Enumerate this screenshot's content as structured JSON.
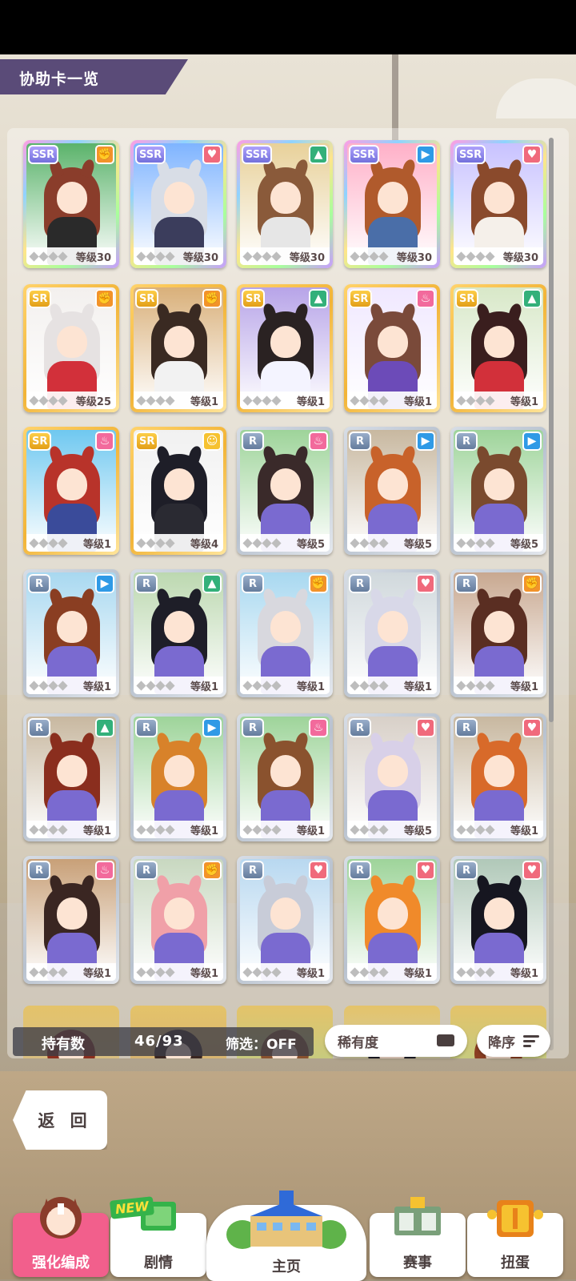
{
  "header": {
    "title": "协助卡一览"
  },
  "cards": [
    {
      "rarity": "SSR",
      "type": "power",
      "level": "等级30",
      "hair": "#8a3d2b",
      "bg": "#5bb36b",
      "outfit": "#2a2a2a"
    },
    {
      "rarity": "SSR",
      "type": "stamina",
      "level": "等级30",
      "hair": "#d8dde6",
      "bg": "#7fb4ff",
      "outfit": "#3b3d5c"
    },
    {
      "rarity": "SSR",
      "type": "wisdom",
      "level": "等级30",
      "hair": "#8a5a3a",
      "bg": "#e8d19a",
      "outfit": "#e6e6e6"
    },
    {
      "rarity": "SSR",
      "type": "speed",
      "level": "等级30",
      "hair": "#b05a2c",
      "bg": "#ffb0c8",
      "outfit": "#4a6ea8"
    },
    {
      "rarity": "SSR",
      "type": "stamina",
      "level": "等级30",
      "hair": "#8a4a2c",
      "bg": "#c8c2ff",
      "outfit": "#f5f0ea"
    },
    {
      "rarity": "SR",
      "type": "power",
      "level": "等级25",
      "hair": "#e6e2e2",
      "bg": "#f3f0ee",
      "outfit": "#d2303a"
    },
    {
      "rarity": "SR",
      "type": "power",
      "level": "等级1",
      "hair": "#3a2a22",
      "bg": "#d9b07a",
      "outfit": "#f2f2f2"
    },
    {
      "rarity": "SR",
      "type": "wisdom",
      "level": "等级1",
      "hair": "#2a2222",
      "bg": "#b7a4e8",
      "outfit": "#f4f4ff"
    },
    {
      "rarity": "SR",
      "type": "guts",
      "level": "等级1",
      "hair": "#7a4a3a",
      "bg": "#f0e8ff",
      "outfit": "#6c4bb8"
    },
    {
      "rarity": "SR",
      "type": "wisdom",
      "level": "等级1",
      "hair": "#3a1e1e",
      "bg": "#d8e8c8",
      "outfit": "#d2303a"
    },
    {
      "rarity": "SR",
      "type": "guts",
      "level": "等级1",
      "hair": "#b8332a",
      "bg": "#6fc8f0",
      "outfit": "#3a4b9a"
    },
    {
      "rarity": "SR",
      "type": "friend",
      "level": "等级4",
      "hair": "#1e1e28",
      "bg": "#f1f1f1",
      "outfit": "#2a2a32"
    },
    {
      "rarity": "R",
      "type": "guts",
      "level": "等级5",
      "hair": "#3a2a2a",
      "bg": "#9ed49a",
      "outfit": "#7a6ad0"
    },
    {
      "rarity": "R",
      "type": "speed",
      "level": "等级5",
      "hair": "#c8622a",
      "bg": "#c8b8a0",
      "outfit": "#7a6ad0"
    },
    {
      "rarity": "R",
      "type": "speed",
      "level": "等级5",
      "hair": "#7a4a2e",
      "bg": "#9ed49a",
      "outfit": "#7a6ad0"
    },
    {
      "rarity": "R",
      "type": "speed",
      "level": "等级1",
      "hair": "#8a3e22",
      "bg": "#a8d8f0",
      "outfit": "#7a6ad0"
    },
    {
      "rarity": "R",
      "type": "wisdom",
      "level": "等级1",
      "hair": "#1e1e28",
      "bg": "#bcd8b0",
      "outfit": "#7a6ad0"
    },
    {
      "rarity": "R",
      "type": "power",
      "level": "等级1",
      "hair": "#d8d8de",
      "bg": "#a8d8f0",
      "outfit": "#7a6ad0"
    },
    {
      "rarity": "R",
      "type": "stamina",
      "level": "等级1",
      "hair": "#d8d8e8",
      "bg": "#d0d8dc",
      "outfit": "#7a6ad0"
    },
    {
      "rarity": "R",
      "type": "power",
      "level": "等级1",
      "hair": "#5a2e22",
      "bg": "#c8a890",
      "outfit": "#7a6ad0"
    },
    {
      "rarity": "R",
      "type": "wisdom",
      "level": "等级1",
      "hair": "#8a2e1e",
      "bg": "#c8b8a0",
      "outfit": "#7a6ad0"
    },
    {
      "rarity": "R",
      "type": "speed",
      "level": "等级1",
      "hair": "#d8822a",
      "bg": "#9ed49a",
      "outfit": "#7a6ad0"
    },
    {
      "rarity": "R",
      "type": "guts",
      "level": "等级1",
      "hair": "#8a522e",
      "bg": "#9ed49a",
      "outfit": "#7a6ad0"
    },
    {
      "rarity": "R",
      "type": "stamina",
      "level": "等级5",
      "hair": "#d8d0e8",
      "bg": "#d8d0c8",
      "outfit": "#7a6ad0"
    },
    {
      "rarity": "R",
      "type": "stamina",
      "level": "等级1",
      "hair": "#d86a2a",
      "bg": "#c8b8a0",
      "outfit": "#7a6ad0"
    },
    {
      "rarity": "R",
      "type": "guts",
      "level": "等级1",
      "hair": "#3a2622",
      "bg": "#c8a078",
      "outfit": "#7a6ad0"
    },
    {
      "rarity": "R",
      "type": "power",
      "level": "等级1",
      "hair": "#f0a0a8",
      "bg": "#c8d8c0",
      "outfit": "#7a6ad0"
    },
    {
      "rarity": "R",
      "type": "stamina",
      "level": "等级1",
      "hair": "#c8ccd8",
      "bg": "#b8d8f0",
      "outfit": "#7a6ad0"
    },
    {
      "rarity": "R",
      "type": "stamina",
      "level": "等级1",
      "hair": "#f08a2a",
      "bg": "#9ed49a",
      "outfit": "#7a6ad0"
    },
    {
      "rarity": "R",
      "type": "stamina",
      "level": "等级1",
      "hair": "#161620",
      "bg": "#b0c8b8",
      "outfit": "#7a6ad0"
    }
  ],
  "partial_cards": [
    {
      "hair": "#8a2e1e",
      "bg": "#c8b8a0"
    },
    {
      "hair": "#3a2622",
      "bg": "#c8a078"
    },
    {
      "hair": "#8a522e",
      "bg": "#9ed49a"
    },
    {
      "hair": "#1e1e28",
      "bg": "#b8d8f0"
    },
    {
      "hair": "#8a3e22",
      "bg": "#9ed49a"
    }
  ],
  "filter_bar": {
    "own_label": "持有数",
    "own_count": "46/93",
    "filter_label": "筛选：OFF",
    "sort_label": "稀有度",
    "order_label": "降序"
  },
  "back_button": {
    "label": "返 回"
  },
  "nav": {
    "enhance": "强化编成",
    "story": "剧情",
    "story_badge": "NEW",
    "home": "主页",
    "race": "赛事",
    "gacha": "扭蛋"
  },
  "type_icons": {
    "power": "power-icon",
    "wisdom": "wisdom-icon",
    "stamina": "stamina-heart-icon",
    "speed": "speed-shoe-icon",
    "guts": "guts-flame-icon",
    "friend": "friend-icon"
  },
  "colors": {
    "accent_pink": "#f25f8c",
    "title_bar": "#5a4b78",
    "power": "#f2932a",
    "wisdom": "#33b07a",
    "stamina": "#f06a7c",
    "speed": "#2f9ae6",
    "guts": "#f26a9c",
    "friend": "#f6c230"
  }
}
